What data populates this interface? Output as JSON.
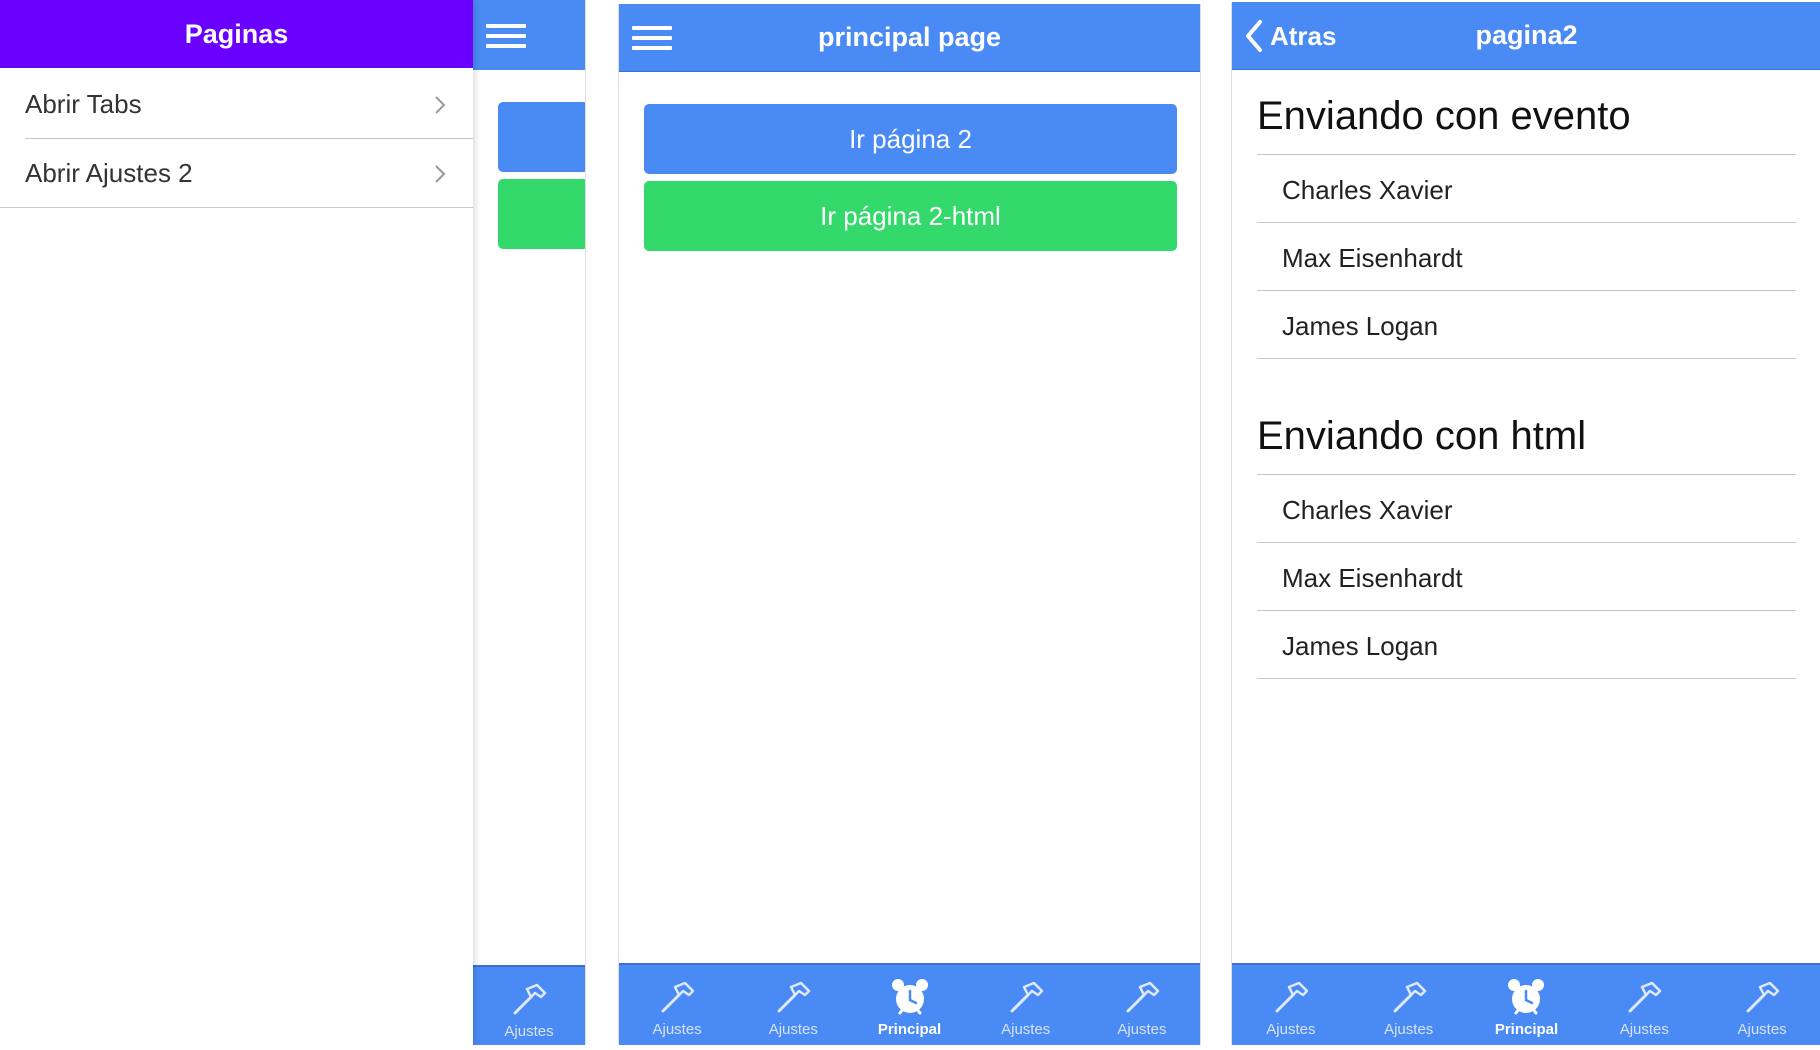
{
  "colors": {
    "header_blue": "#4a8af4",
    "header_purple": "#6a00ff",
    "button_green": "#33d96a",
    "tab_blue": "#4a8af4"
  },
  "menu": {
    "title": "Paginas",
    "items": [
      {
        "label": "Abrir Tabs",
        "icon": "chevron-right-icon"
      },
      {
        "label": "Abrir Ajustes 2",
        "icon": "chevron-right-icon"
      }
    ]
  },
  "principal": {
    "title": "principal page",
    "buttons": [
      {
        "label": "Ir página 2"
      },
      {
        "label": "Ir página 2-html"
      }
    ]
  },
  "pagina2": {
    "title": "pagina2",
    "back_label": "Atras",
    "sections": [
      {
        "title": "Enviando con evento",
        "items": [
          "Charles Xavier",
          "Max Eisenhardt",
          "James Logan"
        ]
      },
      {
        "title": "Enviando con html",
        "items": [
          "Charles Xavier",
          "Max Eisenhardt",
          "James Logan"
        ]
      }
    ]
  },
  "tabs": [
    {
      "label": "Ajustes",
      "icon": "hammer-icon"
    },
    {
      "label": "Ajustes",
      "icon": "hammer-icon"
    },
    {
      "label": "Principal",
      "icon": "alarm-clock-icon",
      "active": true
    },
    {
      "label": "Ajustes",
      "icon": "hammer-icon"
    },
    {
      "label": "Ajustes",
      "icon": "hammer-icon"
    }
  ],
  "partial_tab": {
    "label": "Ajustes",
    "icon": "hammer-icon"
  }
}
